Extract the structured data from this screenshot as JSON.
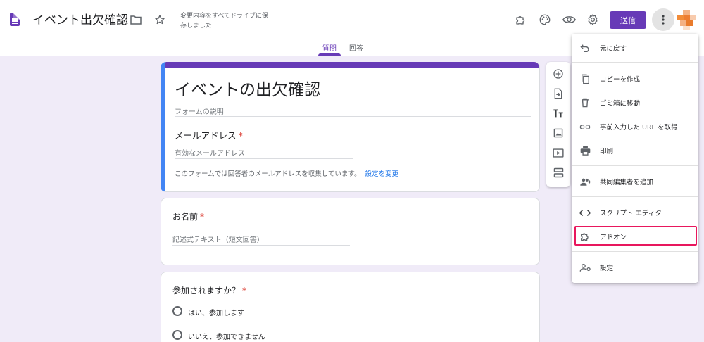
{
  "header": {
    "doc_title": "イベント出欠確認",
    "save_status": "変更内容をすべてドライブに保存しました",
    "send_label": "送信"
  },
  "tabs": [
    {
      "label": "質問",
      "active": true
    },
    {
      "label": "回答",
      "active": false
    }
  ],
  "form": {
    "title": "イベントの出欠確認",
    "description_placeholder": "フォームの説明",
    "email_label": "メールアドレス",
    "email_placeholder": "有効なメールアドレス",
    "email_note": "このフォームでは回答者のメールアドレスを収集しています。",
    "email_note_link": "設定を変更",
    "required_mark": "*"
  },
  "questions": [
    {
      "label": "お名前",
      "placeholder": "記述式テキスト（短文回答）"
    },
    {
      "label": "参加されますか？",
      "options": [
        "はい、参加します",
        "いいえ、参加できません"
      ]
    }
  ],
  "menu": {
    "items": [
      {
        "label": "元に戻す",
        "icon": "undo-icon"
      },
      {
        "label": "コピーを作成",
        "icon": "copy-icon"
      },
      {
        "label": "ゴミ箱に移動",
        "icon": "trash-icon"
      },
      {
        "label": "事前入力した URL を取得",
        "icon": "link-icon"
      },
      {
        "label": "印刷",
        "icon": "print-icon"
      },
      {
        "label": "共同編集者を追加",
        "icon": "add-people-icon"
      },
      {
        "label": "スクリプト エディタ",
        "icon": "code-icon"
      },
      {
        "label": "アドオン",
        "icon": "puzzle-icon",
        "highlighted": true
      },
      {
        "label": "設定",
        "icon": "person-settings-icon"
      }
    ]
  },
  "colors": {
    "brand": "#673ab7",
    "background": "#f0ebf8",
    "link": "#1a73e8",
    "required": "#d93025",
    "highlight": "#e8175d"
  }
}
